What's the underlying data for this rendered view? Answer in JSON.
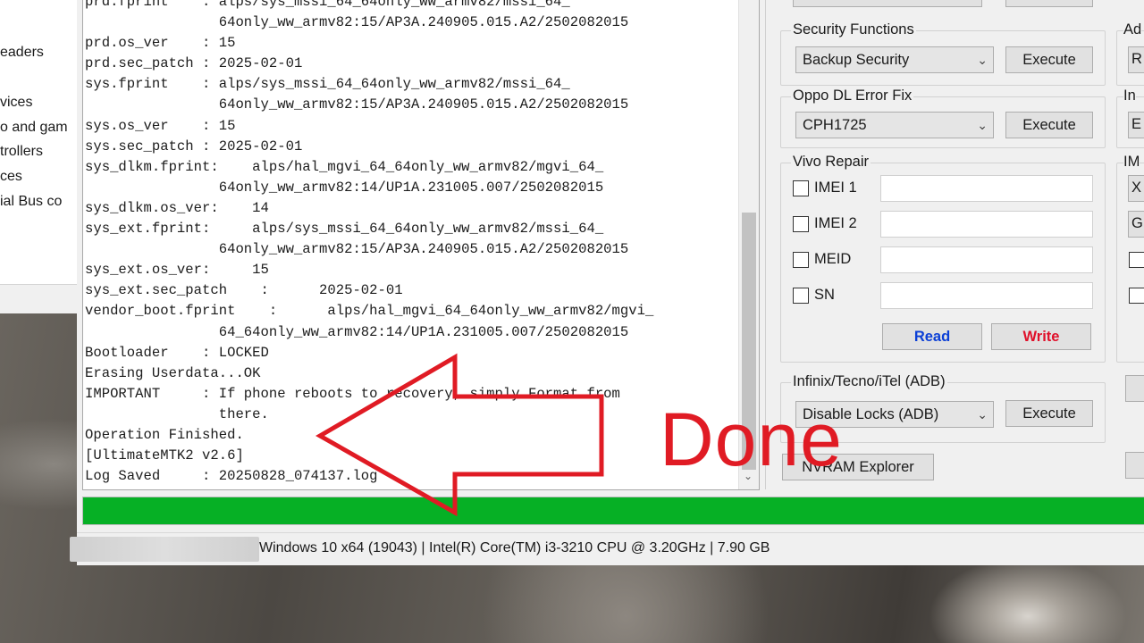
{
  "background_devmgr": {
    "items": [
      "eaders",
      "vices",
      "o and gam",
      "trollers",
      "ces",
      "ial Bus co"
    ]
  },
  "log": {
    "lines": [
      "prd.fprint    : alps/sys_mssi_64_64only_ww_armv82/mssi_64_",
      "                64only_ww_armv82:15/AP3A.240905.015.A2/2502082015",
      "prd.os_ver    : 15",
      "prd.sec_patch : 2025-02-01",
      "sys.fprint    : alps/sys_mssi_64_64only_ww_armv82/mssi_64_",
      "                64only_ww_armv82:15/AP3A.240905.015.A2/2502082015",
      "sys.os_ver    : 15",
      "sys.sec_patch : 2025-02-01",
      "sys_dlkm.fprint:    alps/hal_mgvi_64_64only_ww_armv82/mgvi_64_",
      "                64only_ww_armv82:14/UP1A.231005.007/2502082015",
      "sys_dlkm.os_ver:    14",
      "sys_ext.fprint:     alps/sys_mssi_64_64only_ww_armv82/mssi_64_",
      "                64only_ww_armv82:15/AP3A.240905.015.A2/2502082015",
      "sys_ext.os_ver:     15",
      "sys_ext.sec_patch    :      2025-02-01",
      "vendor_boot.fprint    :      alps/hal_mgvi_64_64only_ww_armv82/mgvi_",
      "                64_64only_ww_armv82:14/UP1A.231005.007/2502082015",
      "Bootloader    : LOCKED",
      "Erasing Userdata...OK",
      "IMPORTANT     : If phone reboots to recovery, simply Format from",
      "                there.",
      "Operation Finished.",
      "[UltimateMTK2 v2.6]",
      "Log Saved     : 20250828_074137.log"
    ]
  },
  "progress": {
    "fraction": 1.0,
    "color": "#06b025"
  },
  "statusbar": {
    "text": "Windows 10 x64 (19043)   |   Intel(R) Core(TM) i3-3210 CPU @ 3.20GHz   |   7.90 GB"
  },
  "security_functions": {
    "title": "Security Functions",
    "selected": "Backup Security",
    "execute_label": "Execute"
  },
  "oppo_dl": {
    "title": "Oppo DL Error Fix",
    "selected": "CPH1725",
    "execute_label": "Execute"
  },
  "vivo_repair": {
    "title": "Vivo Repair",
    "checkboxes": [
      "IMEI 1",
      "IMEI 2",
      "MEID",
      "SN"
    ],
    "read_label": "Read",
    "write_label": "Write",
    "read_color": "#0b3fd6",
    "write_color": "#e0102a"
  },
  "infinix": {
    "title": "Infinix/Tecno/iTel (ADB)",
    "selected": "Disable Locks (ADB)",
    "execute_label": "Execute"
  },
  "nvram_label": "NVRAM Explorer",
  "cut_off_right": {
    "ad": "Ad",
    "in": "In",
    "im": "IM",
    "x": "X",
    "g": "G",
    "r": "R",
    "e": "E"
  },
  "annotation": {
    "done_text": "Done",
    "color": "#e01b24"
  }
}
